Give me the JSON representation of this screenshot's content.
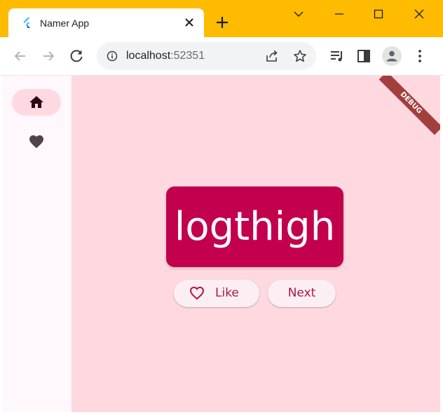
{
  "browser": {
    "tab": {
      "title": "Namer App",
      "favicon": "flutter-icon"
    },
    "url": {
      "host": "localhost",
      "port": ":52351"
    },
    "colors": {
      "frame": "#ffbb00"
    }
  },
  "app": {
    "nav_rail": [
      {
        "icon": "home-icon",
        "selected": true
      },
      {
        "icon": "favorite-icon",
        "selected": false
      }
    ],
    "current_pair": "logthigh",
    "like_label": "Like",
    "next_label": "Next",
    "debug_banner": "DEBUG",
    "colors": {
      "primary": "#c2004e",
      "background": "#ffd9df",
      "rail": "#fef7fb",
      "button": "#fbeff3"
    }
  }
}
